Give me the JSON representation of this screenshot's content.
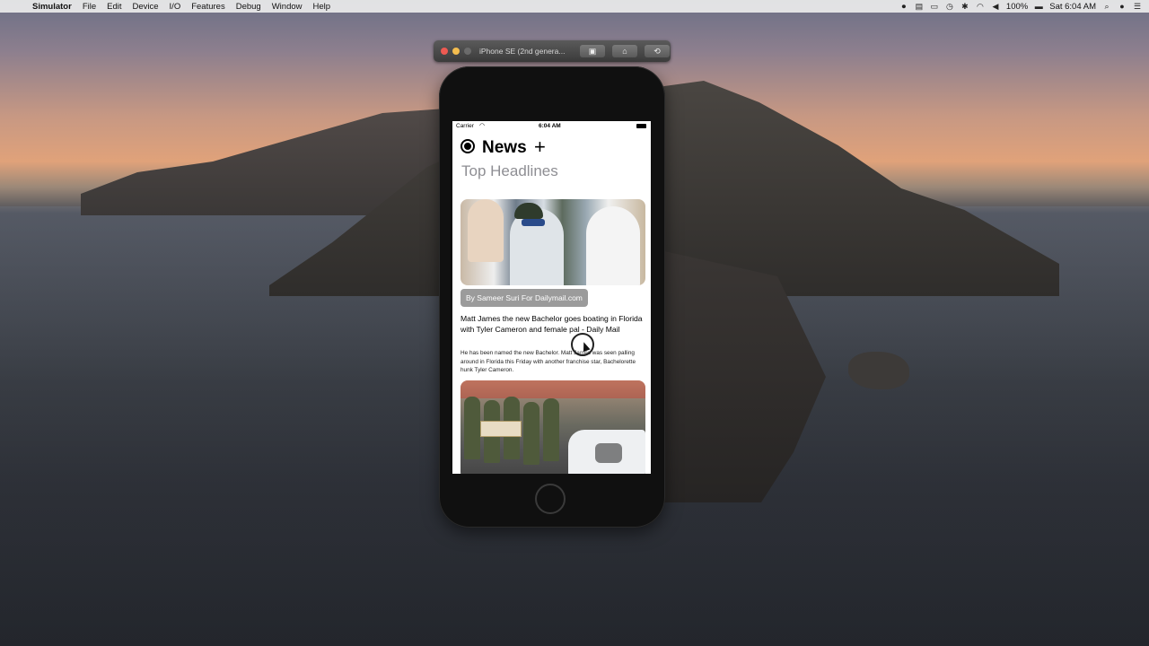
{
  "menubar": {
    "apple_icon": "apple-icon",
    "app_name": "Simulator",
    "menus": [
      "File",
      "Edit",
      "Device",
      "I/O",
      "Features",
      "Debug",
      "Window",
      "Help"
    ],
    "battery_percent": "100%",
    "clock": "Sat 6:04 AM"
  },
  "simulator": {
    "window_title": "iPhone SE (2nd genera...",
    "buttons": {
      "screenshot_icon": "camera-icon",
      "home_icon": "home-icon",
      "rotate_icon": "rotate-icon"
    }
  },
  "device": {
    "status": {
      "carrier": "Carrier",
      "time": "6:04 AM"
    },
    "app": {
      "title": "News",
      "add_symbol": "+",
      "section": "Top Headlines",
      "articles": [
        {
          "source": "By Sameer Suri For Dailymail.com",
          "headline": "Matt James the new Bachelor goes boating in Florida with Tyler Cameron and female pal - Daily Mail",
          "summary": "He has been named the new Bachelor. Matt James was seen palling around in Florida this Friday with another franchise star, Bachelorette hunk Tyler Cameron."
        }
      ]
    }
  },
  "colors": {
    "subtitle_gray": "#8e8e93",
    "source_badge": "#9b9b9b",
    "traffic_red": "#ee5a52",
    "traffic_yellow": "#f4bd4f"
  }
}
